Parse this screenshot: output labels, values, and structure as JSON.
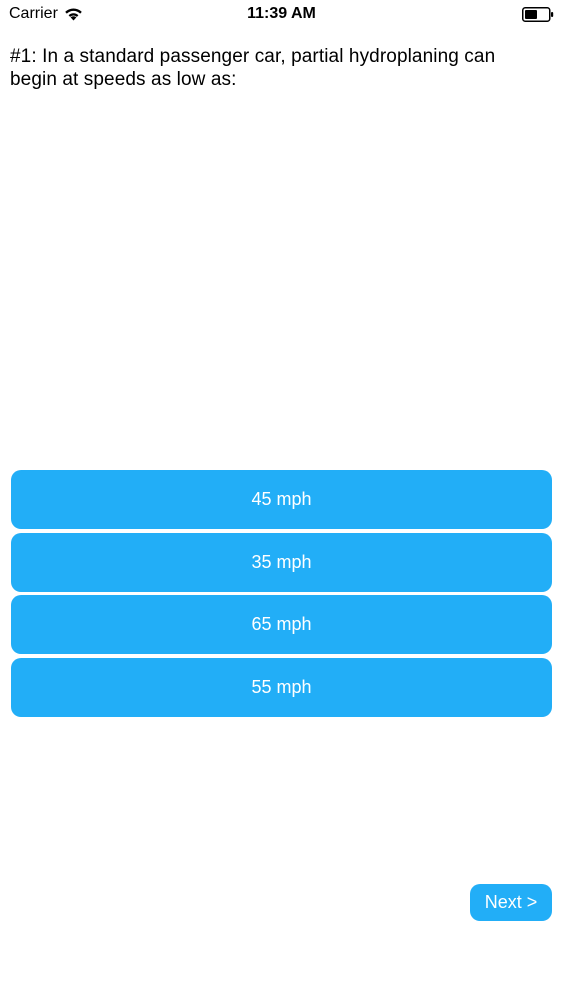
{
  "status_bar": {
    "carrier": "Carrier",
    "time": "11:39 AM",
    "wifi_icon": "wifi-icon",
    "battery_icon": "battery-icon"
  },
  "question": {
    "text": "#1: In a standard passenger car, partial hydroplaning can begin at speeds as low as:"
  },
  "answers": [
    {
      "label": "45 mph"
    },
    {
      "label": "35 mph"
    },
    {
      "label": "65 mph"
    },
    {
      "label": "55 mph"
    }
  ],
  "next_button": {
    "label": "Next >"
  },
  "colors": {
    "accent": "#22aef7",
    "background": "#ffffff",
    "button_text": "#ffffff"
  }
}
